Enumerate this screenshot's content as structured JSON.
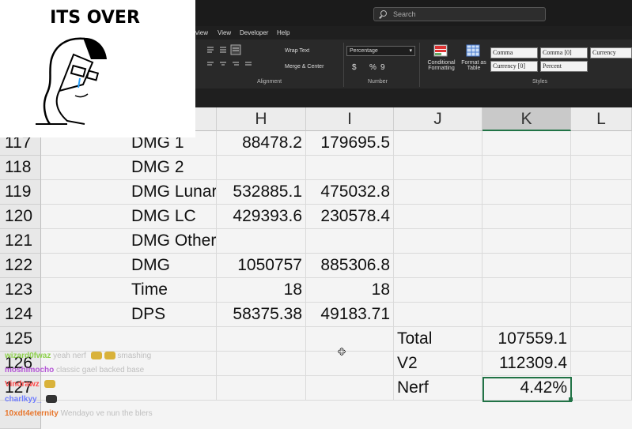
{
  "window": {
    "search_placeholder": "Search"
  },
  "menu": [
    "view",
    "View",
    "Developer",
    "Help"
  ],
  "ribbon": {
    "wrap_text": "Wrap Text",
    "merge_center": "Merge & Center",
    "number_format": "Percentage",
    "number_symbols": [
      "$",
      "%",
      "9"
    ],
    "conditional_formatting": [
      "Conditional",
      "Formatting"
    ],
    "format_as_table": [
      "Format as",
      "Table"
    ],
    "groups": {
      "alignment": "Alignment",
      "number": "Number",
      "styles": "Styles"
    },
    "styles": [
      "Comma",
      "Comma [0]",
      "Currency",
      "Currency [0]",
      "Percent"
    ]
  },
  "columns": [
    "H",
    "I",
    "J",
    "K",
    "L"
  ],
  "selected_column": "K",
  "rows": [
    {
      "num": "117",
      "g": "DMG 1",
      "h": "88478.2",
      "i": "179695.5",
      "j": "",
      "k": ""
    },
    {
      "num": "118",
      "g": "DMG 2",
      "h": "",
      "i": "",
      "j": "",
      "k": ""
    },
    {
      "num": "119",
      "g": "DMG Lunar",
      "h": "532885.1",
      "i": "475032.8",
      "j": "",
      "k": ""
    },
    {
      "num": "120",
      "g": "DMG LC",
      "h": "429393.6",
      "i": "230578.4",
      "j": "",
      "k": ""
    },
    {
      "num": "121",
      "g": "DMG Other",
      "h": "",
      "i": "",
      "j": "",
      "k": ""
    },
    {
      "num": "122",
      "g": "DMG",
      "h": "1050757",
      "i": "885306.8",
      "j": "",
      "k": ""
    },
    {
      "num": "123",
      "g": "Time",
      "h": "18",
      "i": "18",
      "j": "",
      "k": ""
    },
    {
      "num": "124",
      "g": "DPS",
      "h": "58375.38",
      "i": "49183.71",
      "j": "",
      "k": ""
    },
    {
      "num": "125",
      "g": "",
      "h": "",
      "i": "",
      "j": "Total",
      "k": "107559.1"
    },
    {
      "num": "126",
      "g": "",
      "h": "",
      "i": "",
      "j": "V2",
      "k": "112309.4"
    },
    {
      "num": "127",
      "g": "",
      "h": "",
      "i": "",
      "j": "Nerf",
      "k": "4.42%"
    }
  ],
  "meme": {
    "caption": "ITS OVER"
  },
  "chat": [
    {
      "user": "wizard0fwaz",
      "color": "#8fd14f",
      "message": "yeah nerf",
      "tail": "smashing"
    },
    {
      "user": "moshimocho",
      "color": "#b455d6",
      "message": "classic gael",
      "tail": "backed base"
    },
    {
      "user": "Vindrawz",
      "color": "#ff4d4d",
      "message": "",
      "tail": ""
    },
    {
      "user": "charlkyy_",
      "color": "#6f7cff",
      "message": "",
      "tail": ""
    },
    {
      "user": "10xdt4eternity",
      "color": "#e8772e",
      "message": "Wendayo ve nun the blers",
      "tail": ""
    }
  ]
}
